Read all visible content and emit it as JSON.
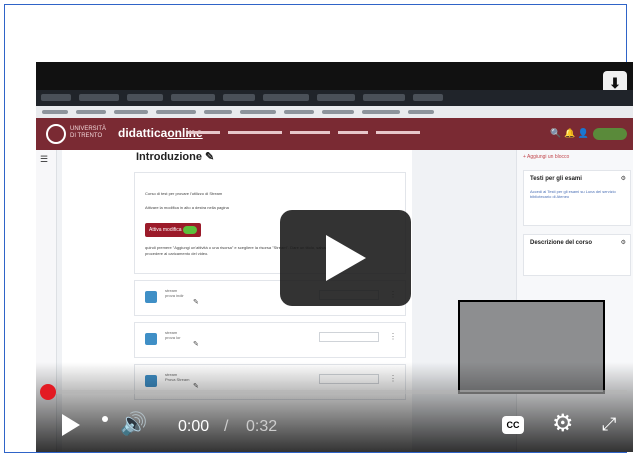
{
  "player": {
    "time_current": "0:00",
    "time_separator": "/",
    "time_duration": "0:32",
    "progress": 0.0,
    "cc_label": "CC",
    "download_glyph": "⬇",
    "icons": [
      "download-icon",
      "play-icon",
      "next-icon",
      "volume-icon",
      "captions-icon",
      "settings-icon",
      "fullscreen-icon"
    ]
  },
  "moodle": {
    "uni_label": "UNIVERSITÀ DI TRENTO",
    "brand_prefix": "didattica",
    "brand_suffix": "online",
    "section_title": "Introduzione",
    "card_line1": "Corso di test per provare l'utilizzo di Stream",
    "card_line2": "Attivare la modifica in alto a destra nella pagina",
    "toggle_label": "Attiva modifica",
    "card_line3": "quindi premere \"Aggiungi un'attività o una risorsa\" e scegliere la risorsa \"Stream\". Dare un titolo, salvare e procedere al caricamento del video.",
    "activities": [
      {
        "label": "stream",
        "sub": "prova indir"
      },
      {
        "label": "stream",
        "sub": "prova lor"
      },
      {
        "label": "stream",
        "sub": "Prova Stream"
      }
    ],
    "right_blocks": [
      {
        "title": "Testi per gli esami",
        "text": "Accedi ai Testi per gli esami su Luna del servizio bibliotecario di Ateneo"
      },
      {
        "title": "Descrizione del corso",
        "text": ""
      }
    ],
    "add_block": "+ Aggiungi un blocco"
  },
  "colors": {
    "frame_border": "#2f64c8",
    "brand_bar": "#7a2a33",
    "progress_red": "#e31b23"
  }
}
